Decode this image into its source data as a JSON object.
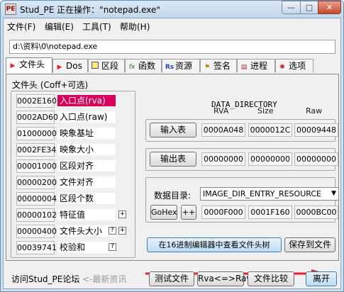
{
  "window": {
    "title": "Stud_PE 正在操作：\"notepad.exe\"",
    "icon": "stud-pe-app-icon",
    "min_glyph": "—",
    "max_glyph": "□",
    "close_glyph": "✕"
  },
  "menu": [
    "文件(F)",
    "编辑(E)",
    "工具(T)",
    "帮助(H)"
  ],
  "file_path": "d:\\资料\\0\\notepad.exe",
  "tabs": [
    {
      "label": "文件头",
      "icon": "red-arrow-icon",
      "active": true
    },
    {
      "label": "Dos",
      "icon": "red-arrow-icon"
    },
    {
      "label": "区段",
      "icon": "section-icon"
    },
    {
      "label": "函数",
      "icon": "fx-icon"
    },
    {
      "label": "资源",
      "icon": "rs-icon"
    },
    {
      "label": "签名",
      "icon": "flag-icon"
    },
    {
      "label": "进程",
      "icon": "process-icon"
    },
    {
      "label": "选项",
      "icon": "gear-icon"
    }
  ],
  "header_group_label": "文件头 (Coff+可选)",
  "header_fields": [
    {
      "value": "0002E160",
      "label": "入口点(rva)",
      "selected": true
    },
    {
      "value": "0002AD60",
      "label": "入口点(raw)"
    },
    {
      "value": "01000000",
      "label": "映象基址"
    },
    {
      "value": "0002FE34",
      "label": "映象大小"
    },
    {
      "value": "00001000",
      "label": "区段对齐"
    },
    {
      "value": "00000200",
      "label": "文件对齐"
    },
    {
      "value": "00000004",
      "label": "区段个数"
    },
    {
      "value": "00000102",
      "label": "特征值",
      "btn": "+"
    },
    {
      "value": "00000400",
      "label": "文件头大小",
      "btn": "?",
      "btn2": "+"
    },
    {
      "value": "00039741",
      "label": "校验和",
      "btn": "?"
    }
  ],
  "data_directory": {
    "title": "DATA_DIRECTORY",
    "columns": [
      "RVA",
      "Size",
      "Raw"
    ],
    "import": {
      "label": "输入表",
      "rva": "0000A048",
      "size": "0000012C",
      "raw": "00009448"
    },
    "export": {
      "label": "输出表",
      "rva": "00000000",
      "size": "00000000",
      "raw": "00000000"
    },
    "dir_label": "数据目录:",
    "dir_selected": "IMAGE_DIR_ENTRY_RESOURCE",
    "gohex_label": "GoHex",
    "plus_label": "++",
    "dir_rva": "0000F000",
    "dir_size": "0001F160",
    "dir_raw": "0000BC00"
  },
  "view_hex_button": "在16进制编辑器中查看文件头树",
  "save_button": "保存到文件",
  "footer": {
    "forum_link": "访问Stud_PE论坛",
    "news_link": "<-最新资讯",
    "test_file": "测试文件",
    "rva_raw": "Rva<=>Raw",
    "compare": "文件比较",
    "leave": "离开"
  },
  "colors": {
    "selected_field": "#d8005c",
    "arrow": "#e8202a",
    "title_bg": "#c4d8ec"
  }
}
